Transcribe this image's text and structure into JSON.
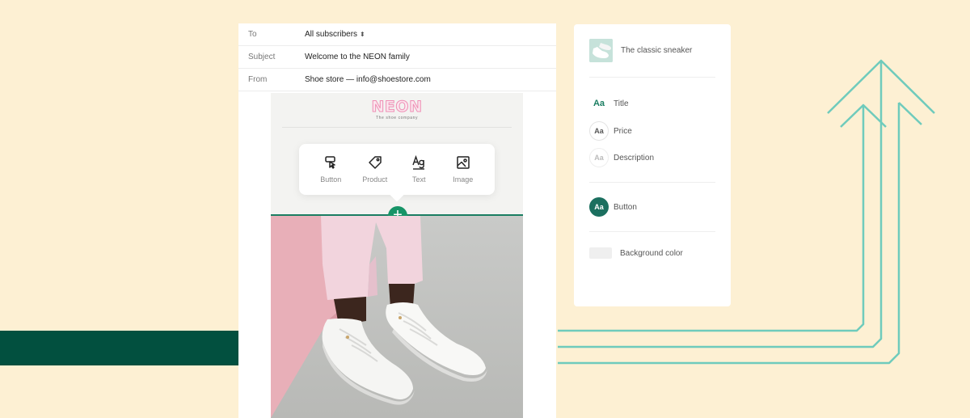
{
  "email": {
    "to_label": "To",
    "to_value": "All subscribers",
    "subject_label": "Subject",
    "subject_value": "Welcome to the NEON family",
    "from_label": "From",
    "from_value": "Shoe store — info@shoestore.com"
  },
  "template": {
    "logo": "NEON",
    "tagline": "The shoe company"
  },
  "block_menu": {
    "items": [
      {
        "label": "Button",
        "icon": "button-icon"
      },
      {
        "label": "Product",
        "icon": "tag-icon"
      },
      {
        "label": "Text",
        "icon": "text-icon"
      },
      {
        "label": "Image",
        "icon": "image-icon"
      }
    ]
  },
  "properties": {
    "product_name": "The classic sneaker",
    "aa": "Aa",
    "title_label": "Title",
    "price_label": "Price",
    "description_label": "Description",
    "button_label": "Button",
    "background_label": "Background color"
  },
  "colors": {
    "background": "#fdf0d3",
    "brand_dark_green": "#02503f",
    "accent_green": "#179467",
    "arrow_teal": "#6fcbbc",
    "logo_pink": "#ef8fb5"
  }
}
